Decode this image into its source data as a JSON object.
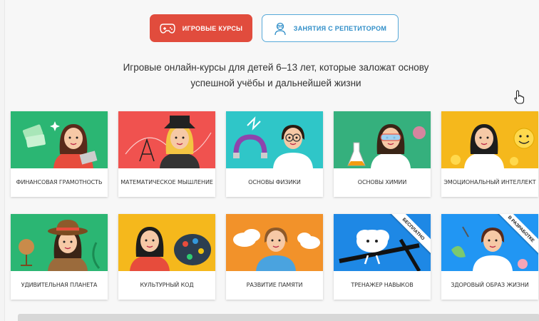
{
  "tabs": {
    "game_courses": "ИГРОВЫЕ КУРСЫ",
    "tutor_lessons": "ЗАНЯТИЯ С РЕПЕТИТОРОМ"
  },
  "subtitle": {
    "line1": "Игровые онлайн-курсы для детей 6–13 лет, которые заложат основу",
    "line2": "успешной учёбы и дальнейшей жизни"
  },
  "colors": {
    "accent_red": "#e14c3d",
    "accent_blue": "#2f8ec8"
  },
  "courses": [
    {
      "label": "ФИНАНСОВАЯ ГРАМОТНОСТЬ",
      "color": "#2bb673",
      "icon": "money-girl"
    },
    {
      "label": "МАТЕМАТИЧЕСКОЕ МЫШЛЕНИЕ",
      "color": "#f0524f",
      "icon": "math-girl"
    },
    {
      "label": "ОСНОВЫ ФИЗИКИ",
      "color": "#2fc6c8",
      "icon": "physics-boy"
    },
    {
      "label": "ОСНОВЫ ХИМИИ",
      "color": "#35b07d",
      "icon": "chemistry-girl"
    },
    {
      "label": "ЭМОЦИОНАЛЬНЫЙ ИНТЕЛЛЕКТ",
      "color": "#f5b81c",
      "icon": "emotion-girl"
    },
    {
      "label": "УДИВИТЕЛЬНАЯ ПЛАНЕТА",
      "color": "#2bb673",
      "icon": "explorer-girl"
    },
    {
      "label": "КУЛЬТУРНЫЙ КОД",
      "color": "#f5b81c",
      "icon": "artist-girl"
    },
    {
      "label": "РАЗВИТИЕ ПАМЯТИ",
      "color": "#f2922a",
      "icon": "memory-boy"
    },
    {
      "label": "ТРЕНАЖЕР НАВЫКОВ",
      "color": "#1e88e5",
      "icon": "brain-runner",
      "ribbon": "БЕСПЛАТНО"
    },
    {
      "label": "ЗДОРОВЫЙ ОБРАЗ ЖИЗНИ",
      "color": "#2196f3",
      "icon": "healthy-boy",
      "ribbon": "В РАЗРАБОТКЕ"
    }
  ]
}
